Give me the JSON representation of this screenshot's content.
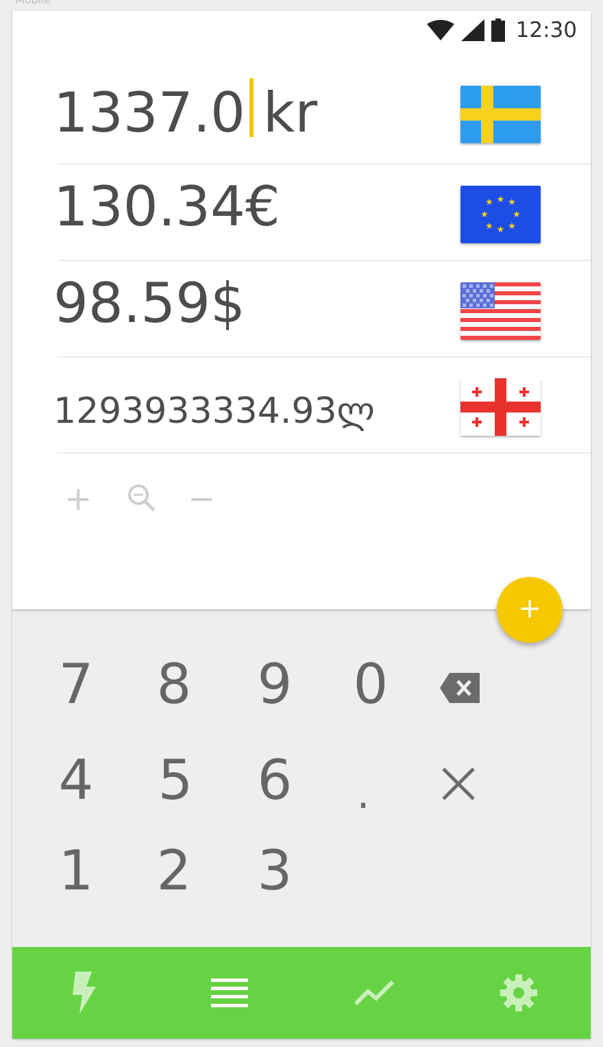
{
  "top_label": "Mobile",
  "status_bar": {
    "time": "12:30"
  },
  "currencies": [
    {
      "amount": "1337.0",
      "suffix": "kr",
      "flag_icon": "sweden-flag-icon"
    },
    {
      "amount": "130.34€",
      "flag_icon": "eu-flag-icon"
    },
    {
      "amount": "98.59$",
      "flag_icon": "us-flag-icon"
    },
    {
      "amount": "1293933334.93ლ",
      "flag_icon": "georgia-flag-icon"
    }
  ],
  "tools": {
    "add": "+",
    "remove": "−"
  },
  "fab": {
    "label": "+"
  },
  "keypad": {
    "row1": [
      "7",
      "8",
      "9",
      "0"
    ],
    "row2": [
      "4",
      "5",
      "6",
      "."
    ],
    "row3": [
      "1",
      "2",
      "3"
    ]
  },
  "colors": {
    "accent": "#f5c800",
    "nav": "#66d344",
    "text": "#4d4d4d"
  },
  "nav_icons": [
    "lightning-icon",
    "list-icon",
    "trend-icon",
    "gear-icon"
  ]
}
